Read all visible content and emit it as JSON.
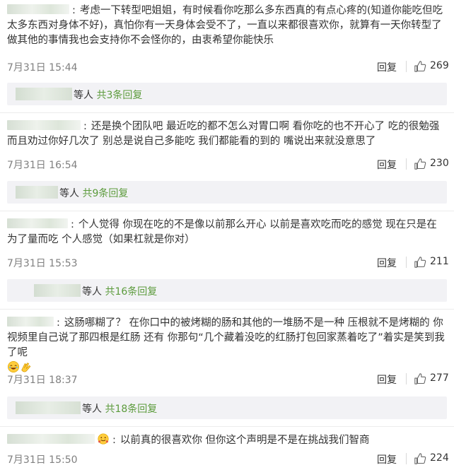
{
  "comments": [
    {
      "text": "考虑一下转型吧姐姐，有时候看你吃那么多东西真的有点心疼的(知道你能吃但吃太多东西对身体不好)，真怕你有一天身体会受不了，一直以来都很喜欢你，就算有一天你转型了做其他的事情我也会支持你不会怪你的，由衷希望你能快乐",
      "time": "7月31日 15:44",
      "reply_label": "回复",
      "likes": "269",
      "sub_prefix": "等人",
      "sub_link": "共3条回复"
    },
    {
      "text": "还是换个团队吧 最近吃的都不怎么对胃口啊 看你吃的也不开心了 吃的很勉强 而且劝过你好几次了 别总是说自己多能吃 我们都能看的到的 嘴说出来就没意思了",
      "time": "7月31日 16:54",
      "reply_label": "回复",
      "likes": "230",
      "sub_prefix": "等人",
      "sub_link": "共9条回复"
    },
    {
      "text": "个人觉得 你现在吃的不是像以前那么开心 以前是喜欢吃而吃的感觉 现在只是在为了量而吃 个人感觉（如果杠就是你对）",
      "time": "7月31日 15:53",
      "reply_label": "回复",
      "likes": "211",
      "sub_prefix": "等人",
      "sub_link": "共16条回复"
    },
    {
      "text": "这肠哪糊了？ 在你口中的被烤糊的肠和其他的一堆肠不是一种 压根就不是烤糊的 你视频里自己说了那四根是红肠 还有 你那句“几个藏着没吃的红肠打包回家蒸着吃了”着实是笑到我了呢",
      "time": "7月31日 18:37",
      "reply_label": "回复",
      "likes": "277",
      "sub_prefix": "等人",
      "sub_link": "共18条回复"
    },
    {
      "text": "以前真的很喜欢你 但你这个声明是不是在挑战我们智商",
      "time": "7月31日 15:50",
      "reply_label": "回复",
      "likes": "224"
    }
  ],
  "icons": {
    "like": "thumbs-up-icon",
    "emoji_laugh": "laughing-emoji-icon",
    "emoji_clap": "clap-emoji-icon",
    "emoji_badge": "hug-emoji-icon"
  },
  "colors": {
    "link_green": "#5c9b3c",
    "reply_bar_bg": "#f2f2f5",
    "meta_gray": "#808080"
  }
}
